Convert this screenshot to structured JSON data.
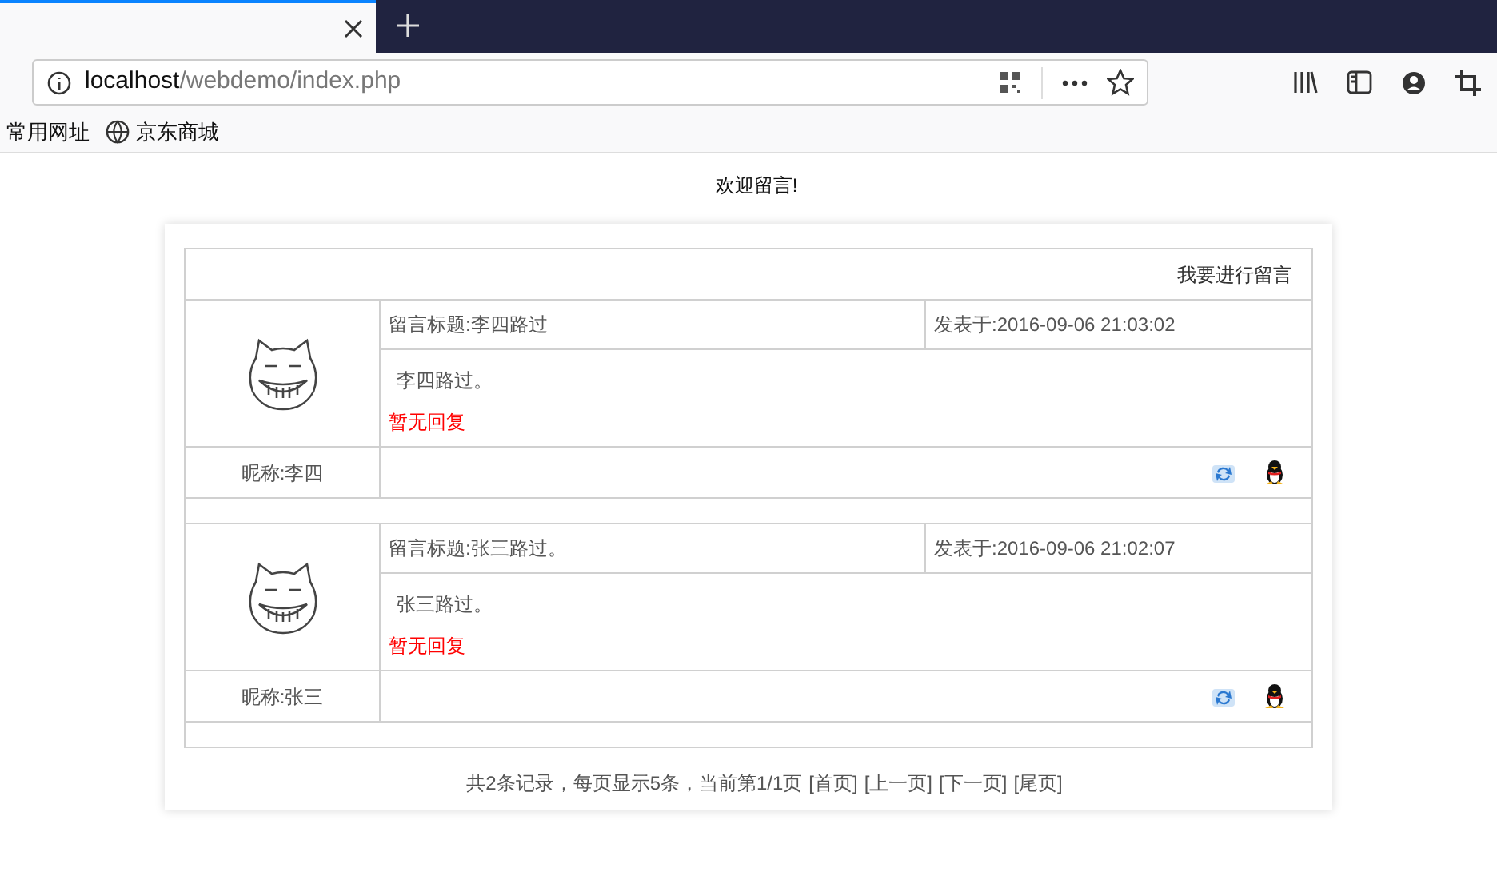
{
  "browser": {
    "url_host": "localhost",
    "url_path": "/webdemo/index.php",
    "bookmarks": [
      "常用网址",
      "京东商城"
    ]
  },
  "page": {
    "heading": "欢迎留言!",
    "new_message_link": "我要进行留言",
    "posts": [
      {
        "title": "留言标题:李四路过",
        "date": "发表于:2016-09-06 21:03:02",
        "body": "李四路过。",
        "reply": "暂无回复",
        "nickname": "昵称:李四"
      },
      {
        "title": "留言标题:张三路过。",
        "date": "发表于:2016-09-06 21:02:07",
        "body": "张三路过。",
        "reply": "暂无回复",
        "nickname": "昵称:张三"
      }
    ],
    "pagination": {
      "summary": "共2条记录，每页显示5条，当前第1/1页",
      "links": [
        "[首页]",
        "[上一页]",
        "[下一页]",
        "[尾页]"
      ]
    }
  }
}
